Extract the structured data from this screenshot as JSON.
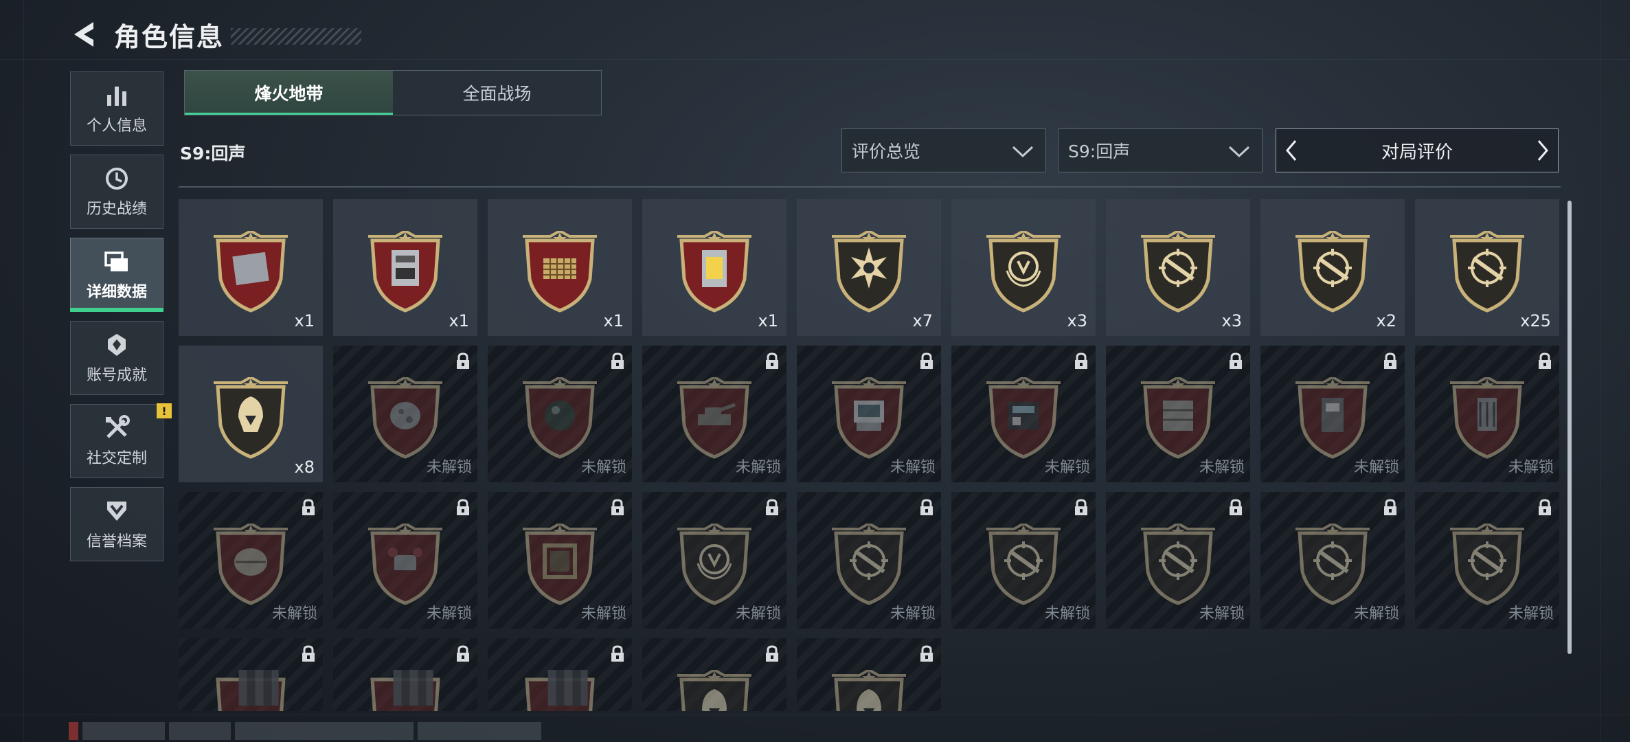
{
  "header": {
    "title": "角色信息"
  },
  "sidebar": {
    "items": [
      {
        "label": "个人信息",
        "icon": "bar-chart-icon",
        "active": false
      },
      {
        "label": "历史战绩",
        "icon": "history-clock-icon",
        "active": false
      },
      {
        "label": "详细数据",
        "icon": "folder-stack-icon",
        "active": true
      },
      {
        "label": "账号成就",
        "icon": "achievement-badge-icon",
        "active": false
      },
      {
        "label": "社交定制",
        "icon": "wrench-screwdriver-icon",
        "active": false,
        "notice": "!"
      },
      {
        "label": "信誉档案",
        "icon": "shield-chevron-icon",
        "active": false
      }
    ]
  },
  "tabs": [
    {
      "label": "烽火地带",
      "active": true
    },
    {
      "label": "全面战场",
      "active": false
    }
  ],
  "season_label": "S9:回声",
  "filters": {
    "overview": "评价总览",
    "season": "S9:回声"
  },
  "pager": {
    "title": "对局评价"
  },
  "locked_text": "未解锁",
  "colors": {
    "accent": "#45d096",
    "badge_gold": "#c9b27a",
    "badge_red": "#7a1f22",
    "notice": "#e8c23a"
  },
  "medals": [
    {
      "icon": "metal-plate-icon",
      "count": "x1",
      "locked": false
    },
    {
      "icon": "server-machine-icon",
      "count": "x1",
      "locked": false
    },
    {
      "icon": "chess-board-icon",
      "count": "x1",
      "locked": false
    },
    {
      "icon": "reactor-core-icon",
      "count": "x1",
      "locked": false
    },
    {
      "icon": "skull-burst-icon",
      "count": "x7",
      "locked": false
    },
    {
      "icon": "laurel-emblem-icon",
      "count": "x3",
      "locked": false
    },
    {
      "icon": "rifle-crosshair-icon",
      "count": "x3",
      "locked": false
    },
    {
      "icon": "smg-crosshair-icon",
      "count": "x2",
      "locked": false
    },
    {
      "icon": "knife-crosshair-icon",
      "count": "x25",
      "locked": false
    },
    {
      "icon": "hooded-figure-icon",
      "count": "x8",
      "locked": false
    },
    {
      "icon": "meteorite-icon",
      "locked": true
    },
    {
      "icon": "dark-orb-icon",
      "locked": true
    },
    {
      "icon": "tank-icon",
      "locked": true
    },
    {
      "icon": "terminal-device-icon",
      "locked": true
    },
    {
      "icon": "circuit-board-icon",
      "locked": true
    },
    {
      "icon": "ammo-crate-icon",
      "locked": true
    },
    {
      "icon": "radio-device-icon",
      "locked": true
    },
    {
      "icon": "lantern-device-icon",
      "locked": true
    },
    {
      "icon": "ornate-box-icon",
      "locked": true
    },
    {
      "icon": "drone-icon",
      "locked": true
    },
    {
      "icon": "painting-frame-icon",
      "locked": true
    },
    {
      "icon": "laurel-emblem-icon",
      "locked": true
    },
    {
      "icon": "sniper-crosshair-icon",
      "locked": true
    },
    {
      "icon": "rifle-crosshair-icon",
      "locked": true
    },
    {
      "icon": "shotgun-crosshair-icon",
      "locked": true
    },
    {
      "icon": "smg-crosshair-icon",
      "locked": true
    },
    {
      "icon": "pistol-crosshair-icon",
      "locked": true
    },
    {
      "icon": "pixelated-medal-icon",
      "locked": true
    },
    {
      "icon": "pixelated-medal-icon",
      "locked": true
    },
    {
      "icon": "pixelated-medal-icon",
      "locked": true
    },
    {
      "icon": "mask-emblem-icon",
      "locked": true
    },
    {
      "icon": "hooded-figure-icon",
      "locked": true
    }
  ]
}
